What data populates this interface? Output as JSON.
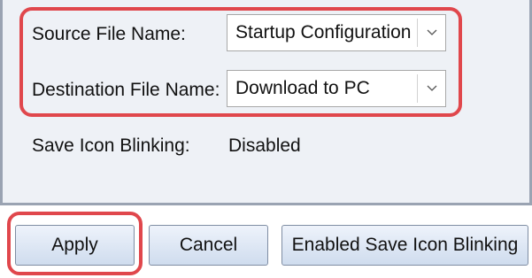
{
  "form": {
    "source": {
      "label": "Source File Name:",
      "value": "Startup Configuration"
    },
    "destination": {
      "label": "Destination File Name:",
      "value": "Download to PC"
    },
    "save_icon_blinking": {
      "label": "Save Icon Blinking:",
      "value": "Disabled"
    }
  },
  "buttons": {
    "apply": "Apply",
    "cancel": "Cancel",
    "enable_blinking": "Enabled Save Icon Blinking"
  },
  "colors": {
    "highlight": "#e0474c",
    "panel_background": "#eef1f6"
  }
}
